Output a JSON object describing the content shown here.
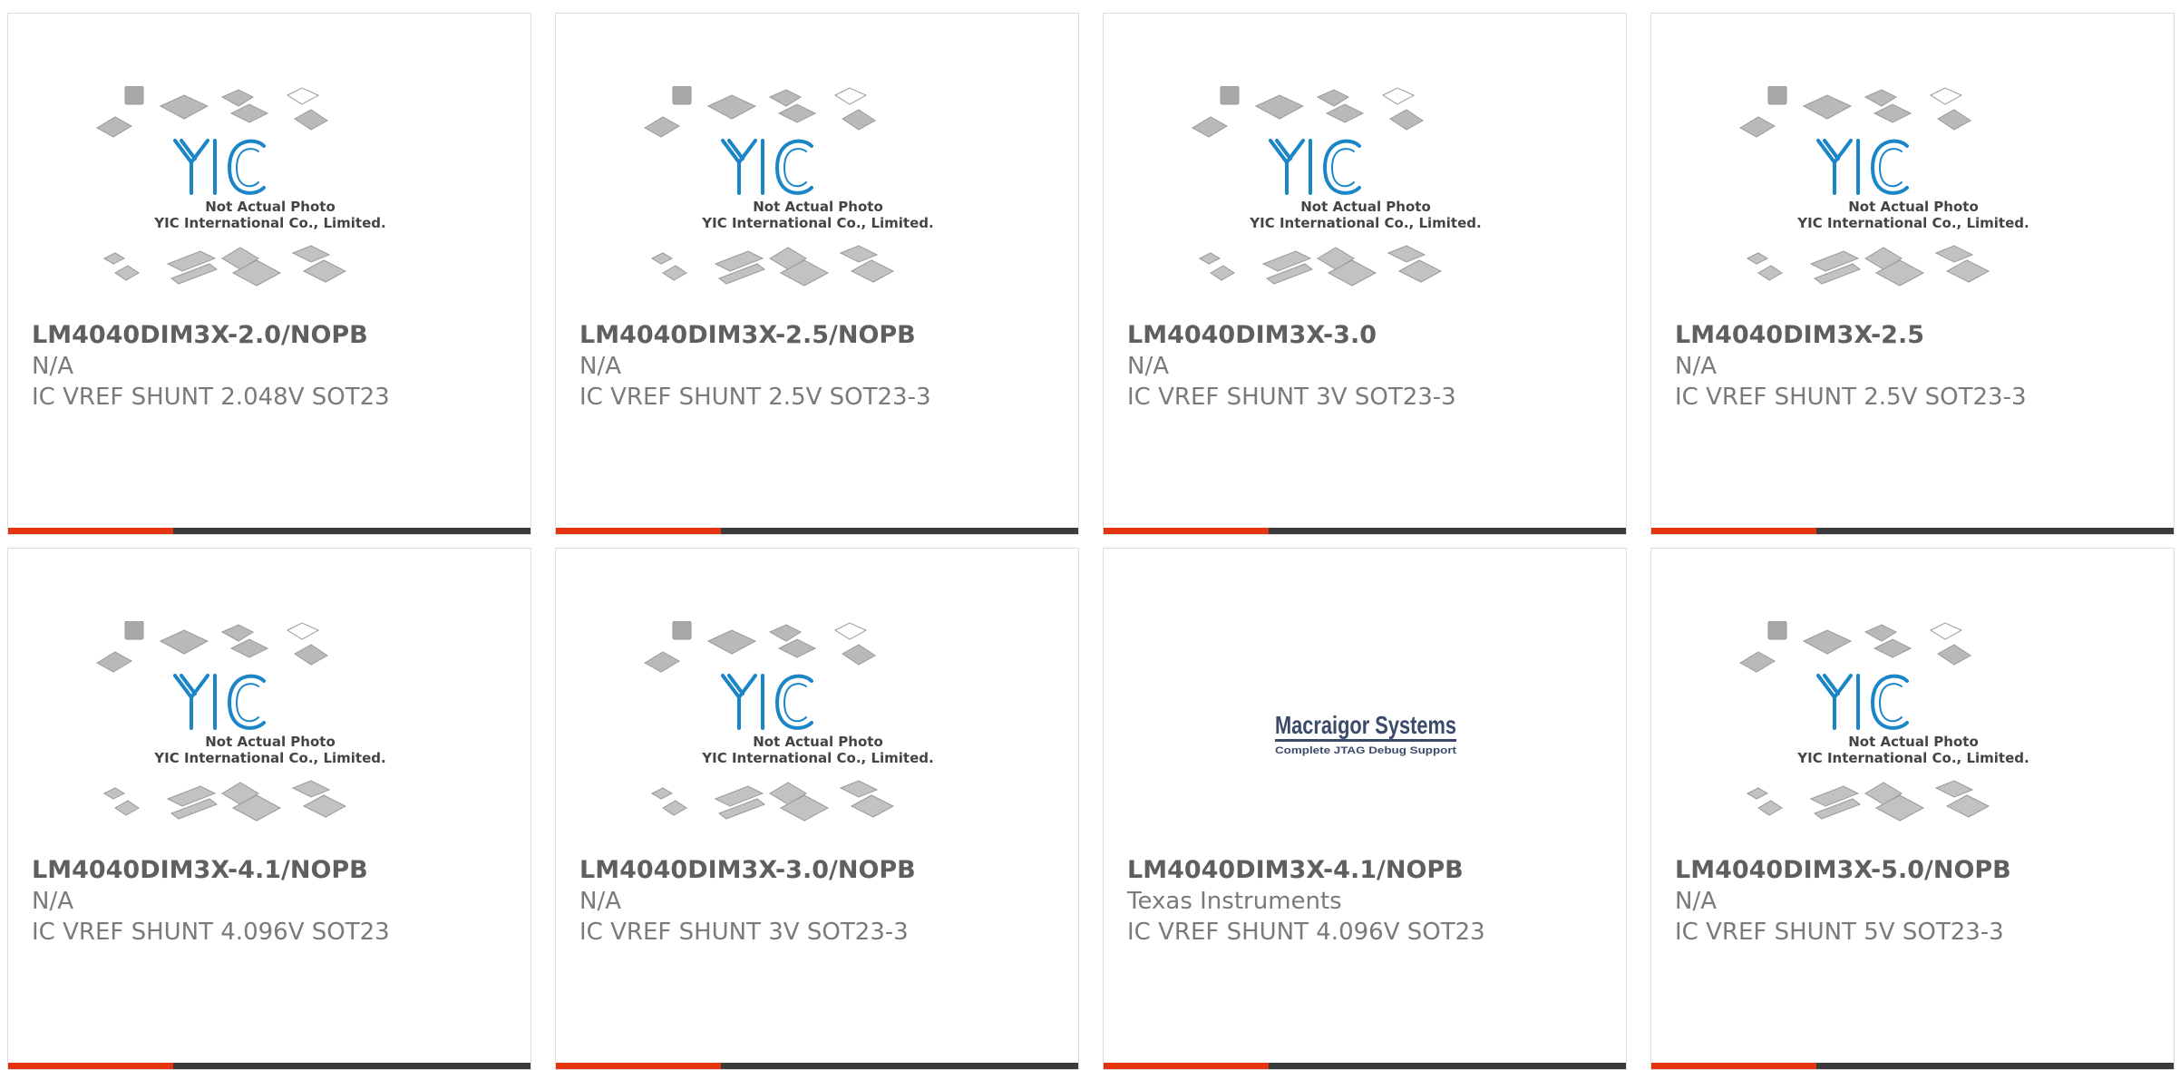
{
  "placeholder": {
    "caption_line1": "Not Actual Photo",
    "caption_line2": "YIC International Co., Limited.",
    "logo_text": "YIC"
  },
  "brand_logo": {
    "name": "Macraigor Systems",
    "tagline": "Complete JTAG Debug Support"
  },
  "colors": {
    "accent": "#e53510",
    "bar": "#3b3b3b",
    "logo_blue": "#1a86c7"
  },
  "products": [
    {
      "part_number": "LM4040DIM3X-2.0/NOPB",
      "manufacturer": "N/A",
      "description": "IC VREF SHUNT 2.048V SOT23",
      "image": "yic-placeholder"
    },
    {
      "part_number": "LM4040DIM3X-2.5/NOPB",
      "manufacturer": "N/A",
      "description": "IC VREF SHUNT 2.5V SOT23-3",
      "image": "yic-placeholder"
    },
    {
      "part_number": "LM4040DIM3X-3.0",
      "manufacturer": "N/A",
      "description": "IC VREF SHUNT 3V SOT23-3",
      "image": "yic-placeholder"
    },
    {
      "part_number": "LM4040DIM3X-2.5",
      "manufacturer": "N/A",
      "description": "IC VREF SHUNT 2.5V SOT23-3",
      "image": "yic-placeholder"
    },
    {
      "part_number": "LM4040DIM3X-4.1/NOPB",
      "manufacturer": "N/A",
      "description": "IC VREF SHUNT 4.096V SOT23",
      "image": "yic-placeholder"
    },
    {
      "part_number": "LM4040DIM3X-3.0/NOPB",
      "manufacturer": "N/A",
      "description": "IC VREF SHUNT 3V SOT23-3",
      "image": "yic-placeholder"
    },
    {
      "part_number": "LM4040DIM3X-4.1/NOPB",
      "manufacturer": "Texas Instruments",
      "description": "IC VREF SHUNT 4.096V SOT23",
      "image": "macraigor-logo"
    },
    {
      "part_number": "LM4040DIM3X-5.0/NOPB",
      "manufacturer": "N/A",
      "description": "IC VREF SHUNT 5V SOT23-3",
      "image": "yic-placeholder"
    }
  ]
}
